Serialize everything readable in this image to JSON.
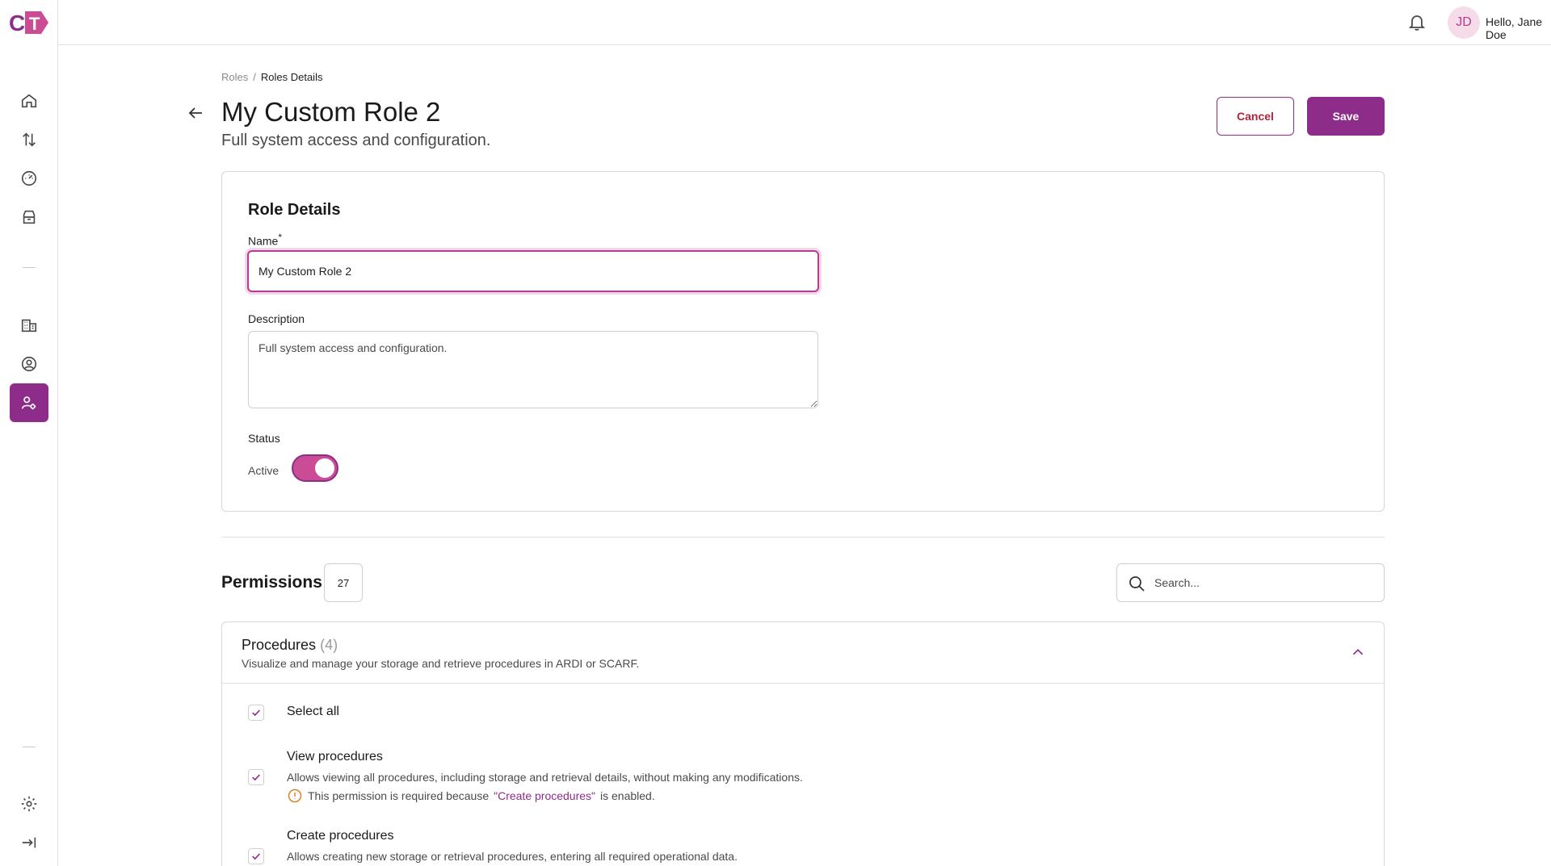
{
  "app": {
    "logo_text": "CT"
  },
  "topbar": {
    "avatar_initials": "JD",
    "greeting": "Hello, Jane Doe"
  },
  "breadcrumb": {
    "root": "Roles",
    "separator": "/",
    "current": "Roles Details"
  },
  "header": {
    "title": "My Custom Role 2",
    "subtitle": "Full system access and configuration.",
    "cancel_label": "Cancel",
    "save_label": "Save"
  },
  "role_details": {
    "title": "Role Details",
    "name_label": "Name",
    "name_required_mark": "*",
    "name_value": "My Custom Role 2",
    "description_label": "Description",
    "description_value": "Full system access and configuration.",
    "status_label": "Status",
    "status_value": "Active",
    "status_on": true
  },
  "permissions": {
    "title": "Permissions",
    "count": "27",
    "search_placeholder": "Search..."
  },
  "procedures": {
    "title": "Procedures",
    "count": "(4)",
    "description": "Visualize and manage your storage and retrieve procedures in ARDI or SCARF.",
    "select_all_label": "Select all",
    "items": [
      {
        "name": "View procedures",
        "description": "Allows viewing all procedures, including storage and retrieval details, without making any modifications.",
        "warning_prefix": "This permission is required because",
        "warning_link": "\"Create procedures\"",
        "warning_suffix": "is enabled.",
        "checked": true
      },
      {
        "name": "Create procedures",
        "description": "Allows creating new storage or retrieval procedures, entering all required operational data.",
        "checked": true
      }
    ]
  },
  "colors": {
    "brand": "#8e2c8a",
    "accent_pink": "#c94c95",
    "cancel_text": "#b0243b",
    "warning": "#d9822b"
  },
  "icons": {
    "sidebar": [
      "home-icon",
      "transfer-icon",
      "gauge-icon",
      "archive-icon",
      "building-icon",
      "user-circle-icon",
      "user-settings-icon",
      "gear-icon",
      "collapse-icon"
    ]
  }
}
